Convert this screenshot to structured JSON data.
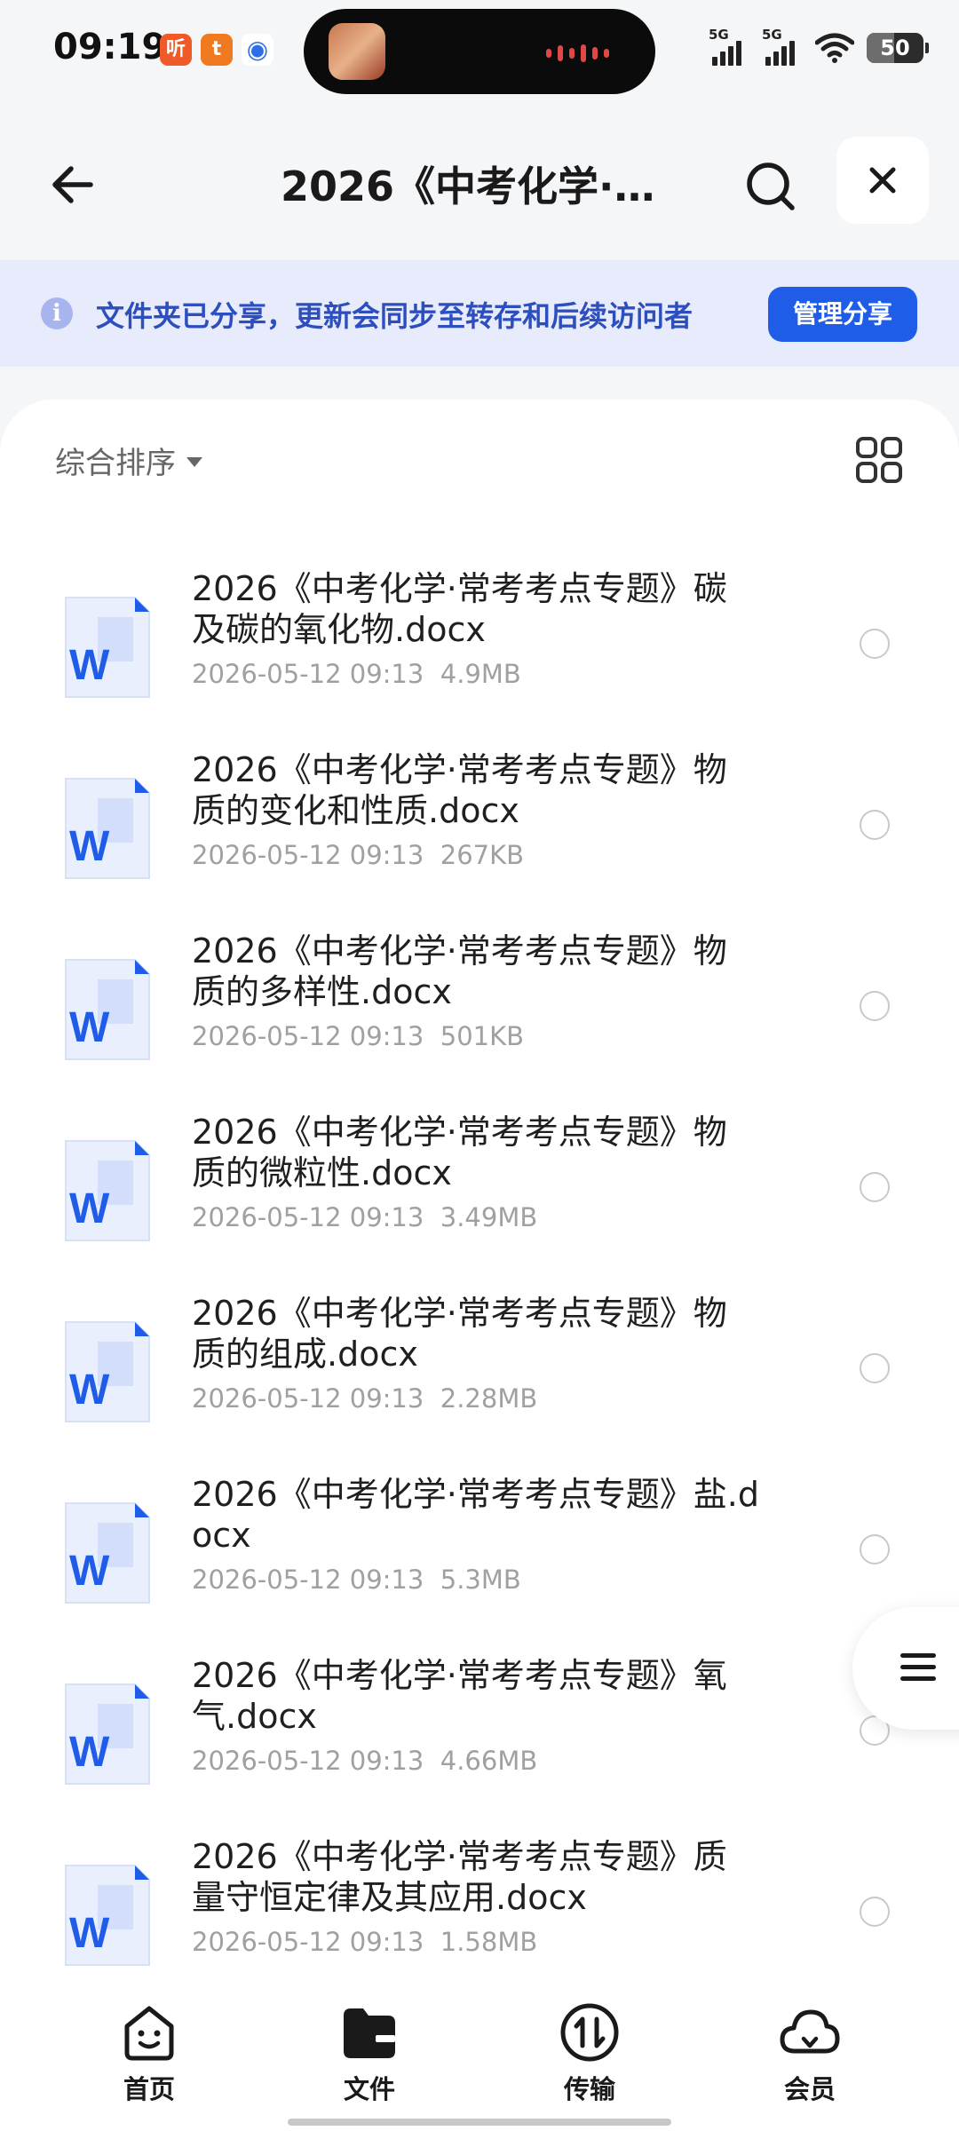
{
  "status_bar": {
    "time": "09:19",
    "notif_icons": [
      {
        "char": "听",
        "color": "#f05a28",
        "name": "listen-app-icon"
      },
      {
        "char": "t",
        "color": "#f07a20",
        "name": "taobao-app-icon"
      },
      {
        "char": "◉",
        "color": "#2d6fe8",
        "name": "circle-app-icon"
      }
    ],
    "signal1_label": "5G",
    "signal2_label": "5G",
    "battery": "50"
  },
  "header": {
    "title": "2026《中考化学·…",
    "back_icon": "arrow-left-icon",
    "search_icon": "search-icon",
    "close_icon": "close-icon"
  },
  "banner": {
    "text": "文件夹已分享，更新会同步至转存和后续访问者",
    "button": "管理分享"
  },
  "toolbar": {
    "sort_label": "综合排序"
  },
  "files": [
    {
      "name": "2026《中考化学·常考考点专题》碳及碳的氧化物.docx",
      "date": "2026-05-12 09:13",
      "size": "4.9MB"
    },
    {
      "name": "2026《中考化学·常考考点专题》物质的变化和性质.docx",
      "date": "2026-05-12 09:13",
      "size": "267KB"
    },
    {
      "name": "2026《中考化学·常考考点专题》物质的多样性.docx",
      "date": "2026-05-12 09:13",
      "size": "501KB"
    },
    {
      "name": "2026《中考化学·常考考点专题》物质的微粒性.docx",
      "date": "2026-05-12 09:13",
      "size": "3.49MB"
    },
    {
      "name": "2026《中考化学·常考考点专题》物质的组成.docx",
      "date": "2026-05-12 09:13",
      "size": "2.28MB"
    },
    {
      "name": "2026《中考化学·常考考点专题》盐.docx",
      "date": "2026-05-12 09:13",
      "size": "5.3MB"
    },
    {
      "name": "2026《中考化学·常考考点专题》氧气.docx",
      "date": "2026-05-12 09:13",
      "size": "4.66MB"
    },
    {
      "name": "2026《中考化学·常考考点专题》质量守恒定律及其应用.docx",
      "date": "2026-05-12 09:13",
      "size": "1.58MB"
    }
  ],
  "bottom_nav": [
    {
      "label": "首页",
      "icon": "home-icon"
    },
    {
      "label": "文件",
      "icon": "folder-icon"
    },
    {
      "label": "传输",
      "icon": "transfer-icon"
    },
    {
      "label": "会员",
      "icon": "member-cloud-icon"
    }
  ],
  "colors": {
    "accent": "#1f5ce8",
    "banner_bg": "#e7ebfb",
    "banner_text": "#2d4fbe",
    "word_blue": "#1f5ce8"
  }
}
